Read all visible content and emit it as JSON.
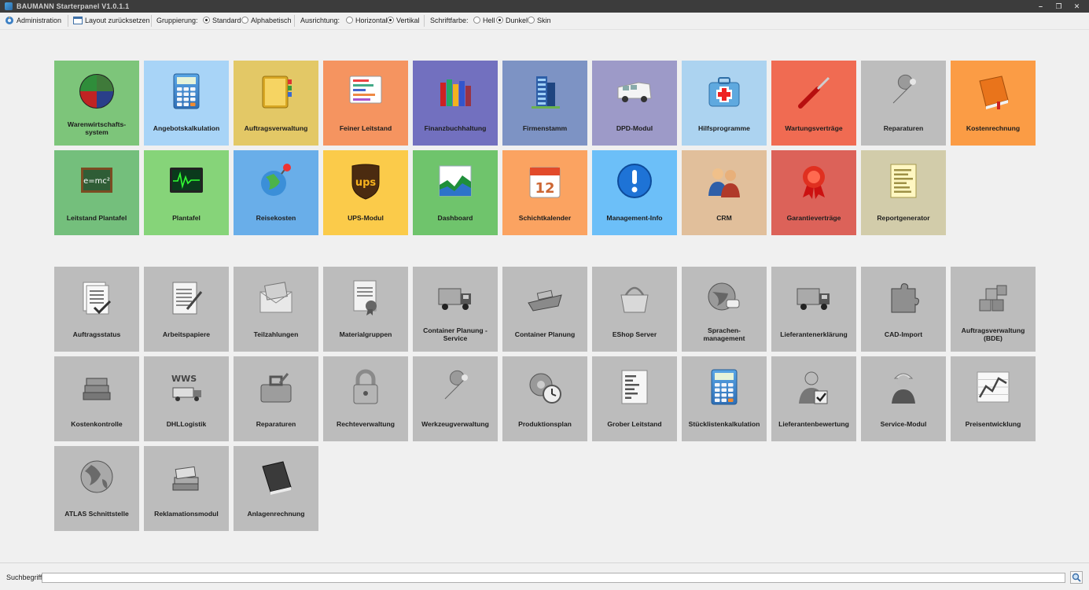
{
  "window": {
    "title": "BAUMANN Starterpanel V1.0.1.1",
    "minimize": "–",
    "restore": "❐",
    "close": "✕"
  },
  "toolbar": {
    "admin_label": "Administration",
    "reset_label": "Layout zurücksetzen",
    "grouping_label": "Gruppierung:",
    "grouping_options": [
      "Standard",
      "Alphabetisch"
    ],
    "grouping_selected": "Standard",
    "orientation_label": "Ausrichtung:",
    "orientation_options": [
      "Horizontal",
      "Vertikal"
    ],
    "orientation_selected": "Vertikal",
    "font_color_label": "Schriftfarbe:",
    "font_color_options": [
      "Hell",
      "Dunkel",
      "Skin"
    ],
    "font_color_selected": "Dunkel"
  },
  "groups": [
    {
      "tiles": [
        {
          "label": "Warenwirtschafts-\nsystem",
          "color": "#7dc57a",
          "icon": "pie-chart-icon"
        },
        {
          "label": "Angebotskalkulation",
          "color": "#a8d4f7",
          "icon": "calculator-icon"
        },
        {
          "label": "Auftragsverwaltung",
          "color": "#e3c866",
          "icon": "address-book-icon"
        },
        {
          "label": "Feiner Leitstand",
          "color": "#f59460",
          "icon": "schedule-board-icon"
        },
        {
          "label": "Finanzbuchhaltung",
          "color": "#7270bf",
          "icon": "books-icon"
        },
        {
          "label": "Firmenstamm",
          "color": "#7d93c4",
          "icon": "office-building-icon"
        },
        {
          "label": "DPD-Modul",
          "color": "#9d9ac8",
          "icon": "delivery-van-icon"
        },
        {
          "label": "Hilfsprogramme",
          "color": "#acd3f0",
          "icon": "first-aid-kit-icon"
        },
        {
          "label": "Wartungsverträge",
          "color": "#f06b52",
          "icon": "screwdriver-icon"
        },
        {
          "label": "Reparaturen",
          "color": "#bdbdbd",
          "icon": "wrench-icon"
        },
        {
          "label": "Kostenrechnung",
          "color": "#fb9c45",
          "icon": "orange-book-icon"
        },
        {
          "label": "Leitstand Plantafel",
          "color": "#74bf7c",
          "icon": "chalkboard-icon"
        },
        {
          "label": "Plantafel",
          "color": "#86d479",
          "icon": "monitor-wave-icon"
        },
        {
          "label": "Reisekosten",
          "color": "#69aee9",
          "icon": "globe-pin-icon"
        },
        {
          "label": "UPS-Modul",
          "color": "#fbcb4a",
          "icon": "ups-shield-icon"
        },
        {
          "label": "Dashboard",
          "color": "#6fc46c",
          "icon": "area-chart-icon"
        },
        {
          "label": "Schichtkalender",
          "color": "#fba361",
          "icon": "calendar-icon"
        },
        {
          "label": "Management-Info",
          "color": "#6cbff8",
          "icon": "info-exclamation-icon"
        },
        {
          "label": "CRM",
          "color": "#e1bf9b",
          "icon": "people-group-icon"
        },
        {
          "label": "Garantieverträge",
          "color": "#dc6259",
          "icon": "award-ribbon-icon"
        },
        {
          "label": "Reportgenerator",
          "color": "#d2ccaa",
          "icon": "report-document-icon"
        }
      ]
    },
    {
      "tiles": [
        {
          "label": "Auftragsstatus",
          "color": "#bcbcbc",
          "icon": "documents-check-icon"
        },
        {
          "label": "Arbeitspapiere",
          "color": "#bcbcbc",
          "icon": "clipboard-pen-icon"
        },
        {
          "label": "Teilzahlungen",
          "color": "#bcbcbc",
          "icon": "money-envelope-icon"
        },
        {
          "label": "Materialgruppen",
          "color": "#bcbcbc",
          "icon": "certificate-icon"
        },
        {
          "label": "Container Planung - Service",
          "color": "#bcbcbc",
          "icon": "truck-icon"
        },
        {
          "label": "Container Planung",
          "color": "#bcbcbc",
          "icon": "cargo-ship-icon"
        },
        {
          "label": "EShop Server",
          "color": "#bcbcbc",
          "icon": "shopping-basket-icon"
        },
        {
          "label": "Sprachen-\nmanagement",
          "color": "#bcbcbc",
          "icon": "globe-speech-icon"
        },
        {
          "label": "Lieferantenerklärung",
          "color": "#bcbcbc",
          "icon": "truck-icon"
        },
        {
          "label": "CAD-Import",
          "color": "#bcbcbc",
          "icon": "puzzle-piece-icon"
        },
        {
          "label": "Auftragsverwaltung\n(BDE)",
          "color": "#bcbcbc",
          "icon": "cubes-icon"
        },
        {
          "label": "Kostenkontrolle",
          "color": "#bcbcbc",
          "icon": "book-stack-icon"
        },
        {
          "label": "DHLLogistik",
          "color": "#bcbcbc",
          "icon": "wws-logistics-icon"
        },
        {
          "label": "Reparaturen",
          "color": "#bcbcbc",
          "icon": "toolbox-icon"
        },
        {
          "label": "Rechteverwaltung",
          "color": "#bcbcbc",
          "icon": "padlock-icon"
        },
        {
          "label": "Werkzeugverwaltung",
          "color": "#bcbcbc",
          "icon": "wrench-icon"
        },
        {
          "label": "Produktionsplan",
          "color": "#bcbcbc",
          "icon": "gear-clock-icon"
        },
        {
          "label": "Grober Leitstand",
          "color": "#bcbcbc",
          "icon": "document-list-icon"
        },
        {
          "label": "Stücklistenkalkulation",
          "color": "#bcbcbc",
          "icon": "calculator-icon"
        },
        {
          "label": "Lieferantenbewertung",
          "color": "#bcbcbc",
          "icon": "person-check-icon"
        },
        {
          "label": "Service-Modul",
          "color": "#bcbcbc",
          "icon": "worker-icon"
        },
        {
          "label": "Preisentwicklung",
          "color": "#bcbcbc",
          "icon": "line-chart-icon"
        },
        {
          "label": "ATLAS Schnittstelle",
          "color": "#bcbcbc",
          "icon": "globe-icon"
        },
        {
          "label": "Reklamationsmodul",
          "color": "#bcbcbc",
          "icon": "books-stack-icon"
        },
        {
          "label": "Anlagenrechnung",
          "color": "#bcbcbc",
          "icon": "dark-book-icon"
        }
      ]
    }
  ],
  "search": {
    "label": "Suchbegriff",
    "value": ""
  }
}
